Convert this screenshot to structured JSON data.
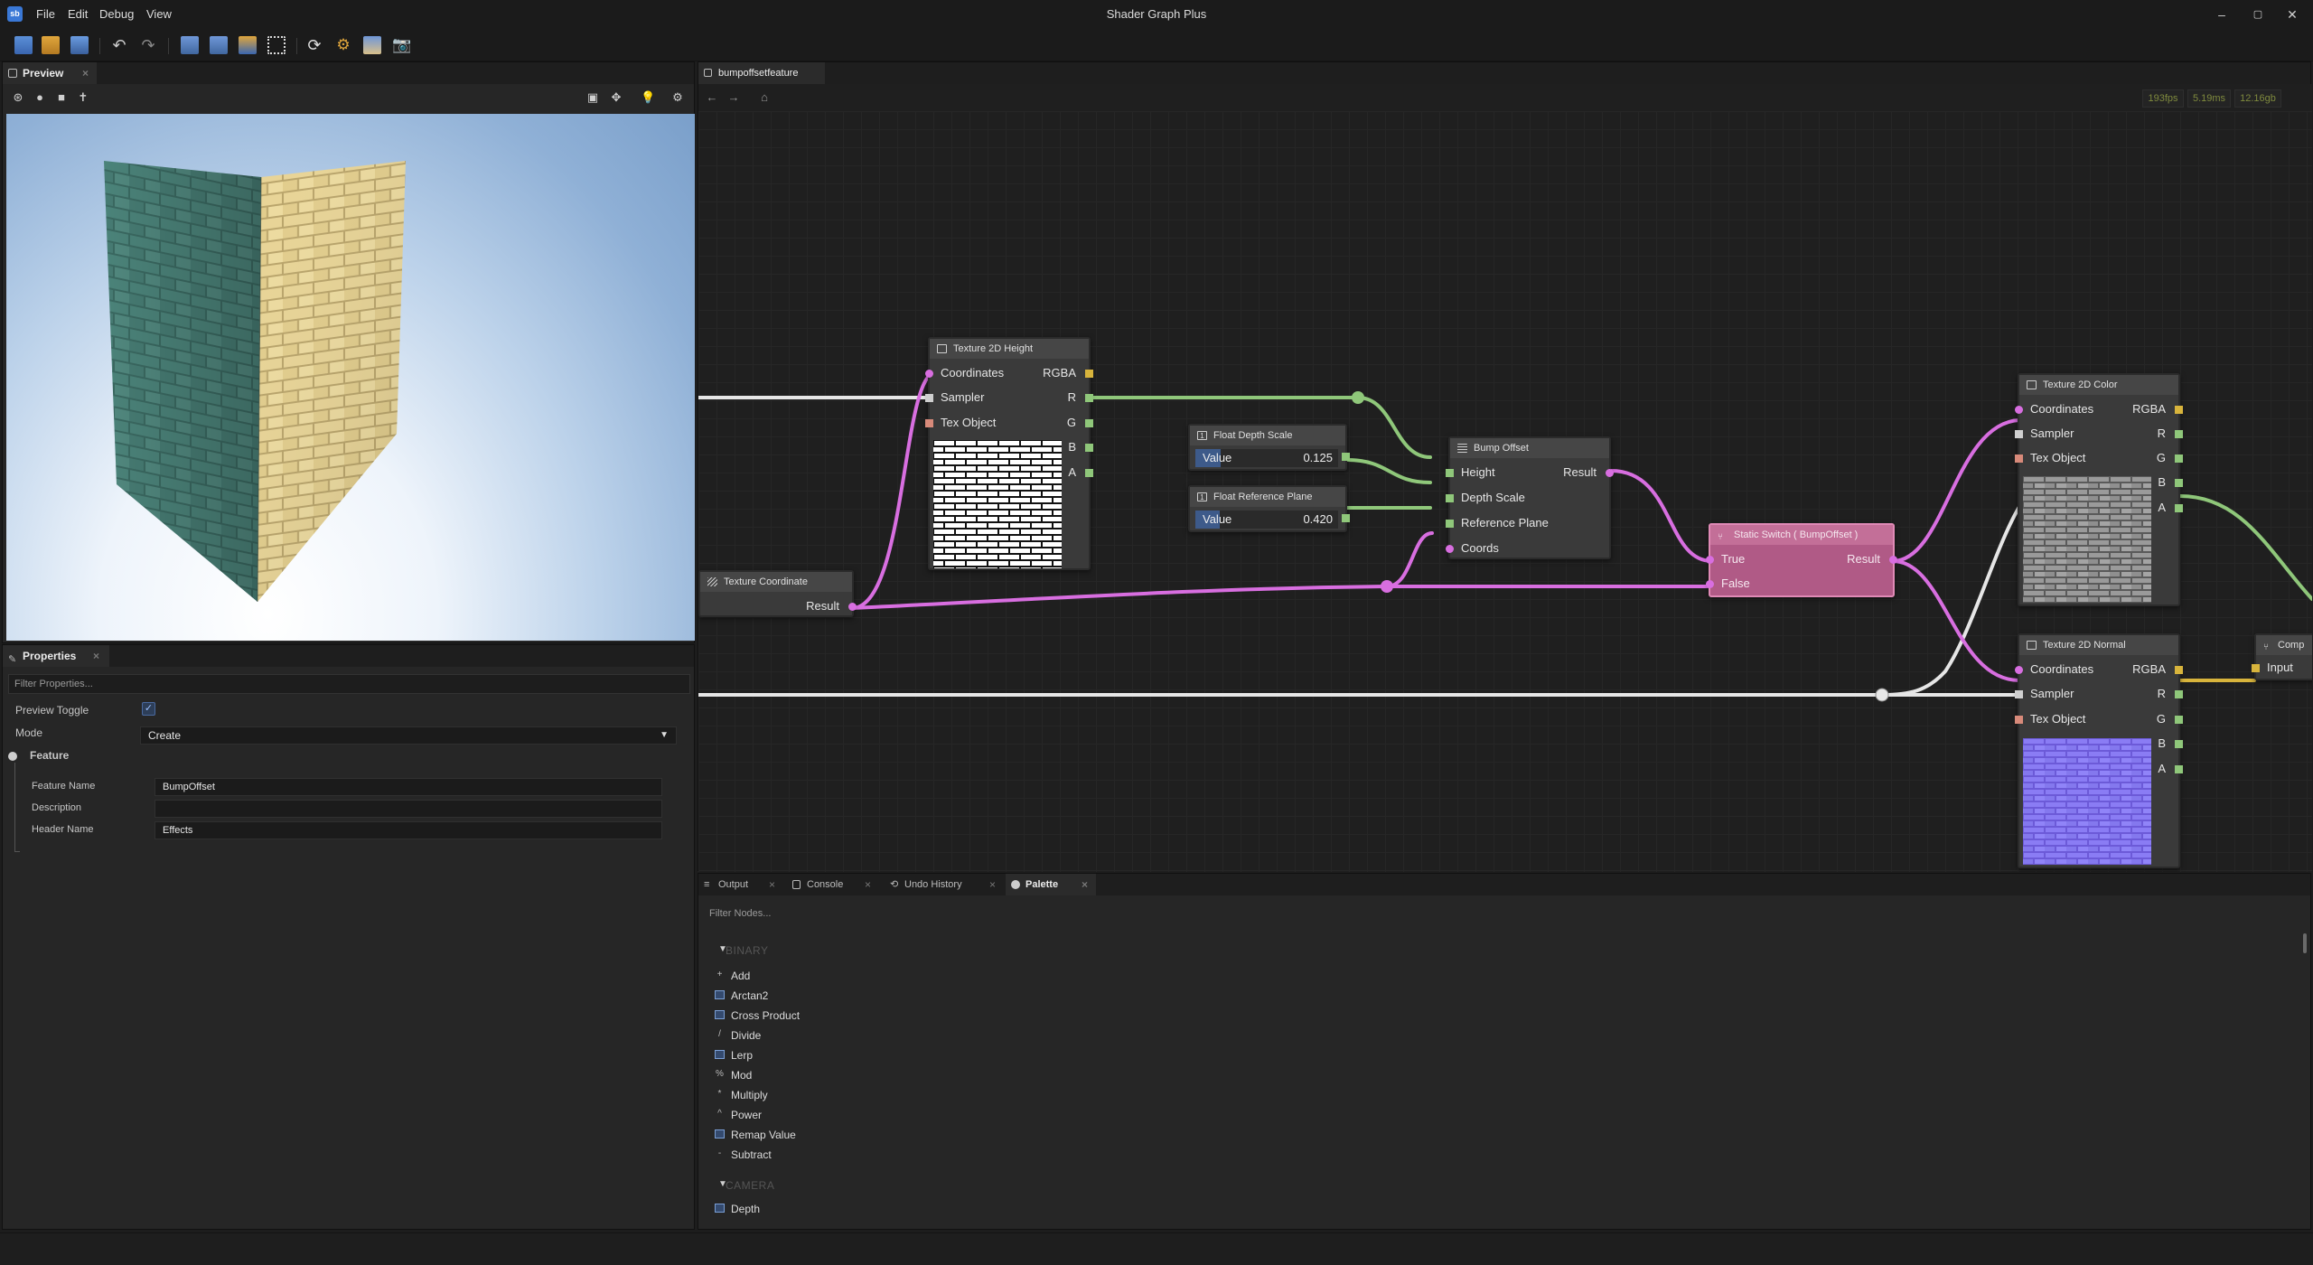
{
  "app": {
    "title": "Shader Graph Plus",
    "logo": "sb"
  },
  "menu": [
    "File",
    "Edit",
    "Debug",
    "View"
  ],
  "window_controls": [
    "–",
    "▢",
    "✕"
  ],
  "preview": {
    "tab": "Preview",
    "close": "×"
  },
  "properties": {
    "tab": "Properties",
    "close": "×",
    "filter_placeholder": "Filter Properties...",
    "preview_toggle_label": "Preview Toggle",
    "preview_toggle_check": "✓",
    "mode_label": "Mode",
    "mode_value": "Create",
    "feature_group": "Feature",
    "feature_name_label": "Feature Name",
    "feature_name_value": "BumpOffset",
    "description_label": "Description",
    "description_value": "",
    "header_name_label": "Header Name",
    "header_name_value": "Effects"
  },
  "graph": {
    "tab": "bumpoffsetfeature",
    "stats": {
      "fps": "193fps",
      "ms": "5.19ms",
      "mem": "12.16gb"
    }
  },
  "nodes": {
    "tex_height": {
      "title": "Texture 2D Height",
      "in": [
        "Coordinates",
        "Sampler",
        "Tex Object"
      ],
      "out": [
        "RGBA",
        "R",
        "G",
        "B",
        "A"
      ]
    },
    "tex_coord": {
      "title": "Texture Coordinate",
      "out": "Result"
    },
    "depth_scale": {
      "title": "Float Depth Scale",
      "label": "Value",
      "value": "0.125",
      "fill": 0.125
    },
    "ref_plane": {
      "title": "Float Reference Plane",
      "label": "Value",
      "value": "0.420",
      "fill": 0.42
    },
    "bump_offset": {
      "title": "Bump Offset",
      "in": [
        "Height",
        "Depth Scale",
        "Reference Plane",
        "Coords"
      ],
      "out": "Result"
    },
    "static_switch": {
      "title": "Static Switch ( BumpOffset )",
      "in": [
        "True",
        "False"
      ],
      "out": "Result"
    },
    "tex_color": {
      "title": "Texture 2D Color",
      "in": [
        "Coordinates",
        "Sampler",
        "Tex Object"
      ],
      "out": [
        "RGBA",
        "R",
        "G",
        "B",
        "A"
      ]
    },
    "tex_normal": {
      "title": "Texture 2D Normal",
      "in": [
        "Coordinates",
        "Sampler",
        "Tex Object"
      ],
      "out": [
        "RGBA",
        "R",
        "G",
        "B",
        "A"
      ]
    },
    "comp": {
      "title": "Comp",
      "in": "Input"
    }
  },
  "bottom_tabs": [
    {
      "label": "Output",
      "icon": "list-icon"
    },
    {
      "label": "Console",
      "icon": "console-icon"
    },
    {
      "label": "Undo History",
      "icon": "history-icon"
    },
    {
      "label": "Palette",
      "icon": "palette-icon"
    }
  ],
  "palette": {
    "filter_placeholder": "Filter Nodes...",
    "categories": [
      {
        "name": "BINARY",
        "items": [
          {
            "label": "Add",
            "glyph": "+"
          },
          {
            "label": "Arctan2",
            "glyph": ""
          },
          {
            "label": "Cross Product",
            "glyph": ""
          },
          {
            "label": "Divide",
            "glyph": "/"
          },
          {
            "label": "Lerp",
            "glyph": ""
          },
          {
            "label": "Mod",
            "glyph": "%"
          },
          {
            "label": "Multiply",
            "glyph": "*"
          },
          {
            "label": "Power",
            "glyph": "^"
          },
          {
            "label": "Remap Value",
            "glyph": ""
          },
          {
            "label": "Subtract",
            "glyph": "-"
          }
        ]
      },
      {
        "name": "CAMERA",
        "items": [
          {
            "label": "Depth",
            "glyph": ""
          }
        ]
      }
    ]
  },
  "colors": {
    "accent": "#3a78d6",
    "wire_float": "#8fc77a",
    "wire_vec2": "#d86ee0",
    "wire_sampler": "#e6e6e6",
    "wire_color": "#d8b43c",
    "switch_node": "#b05a86"
  }
}
